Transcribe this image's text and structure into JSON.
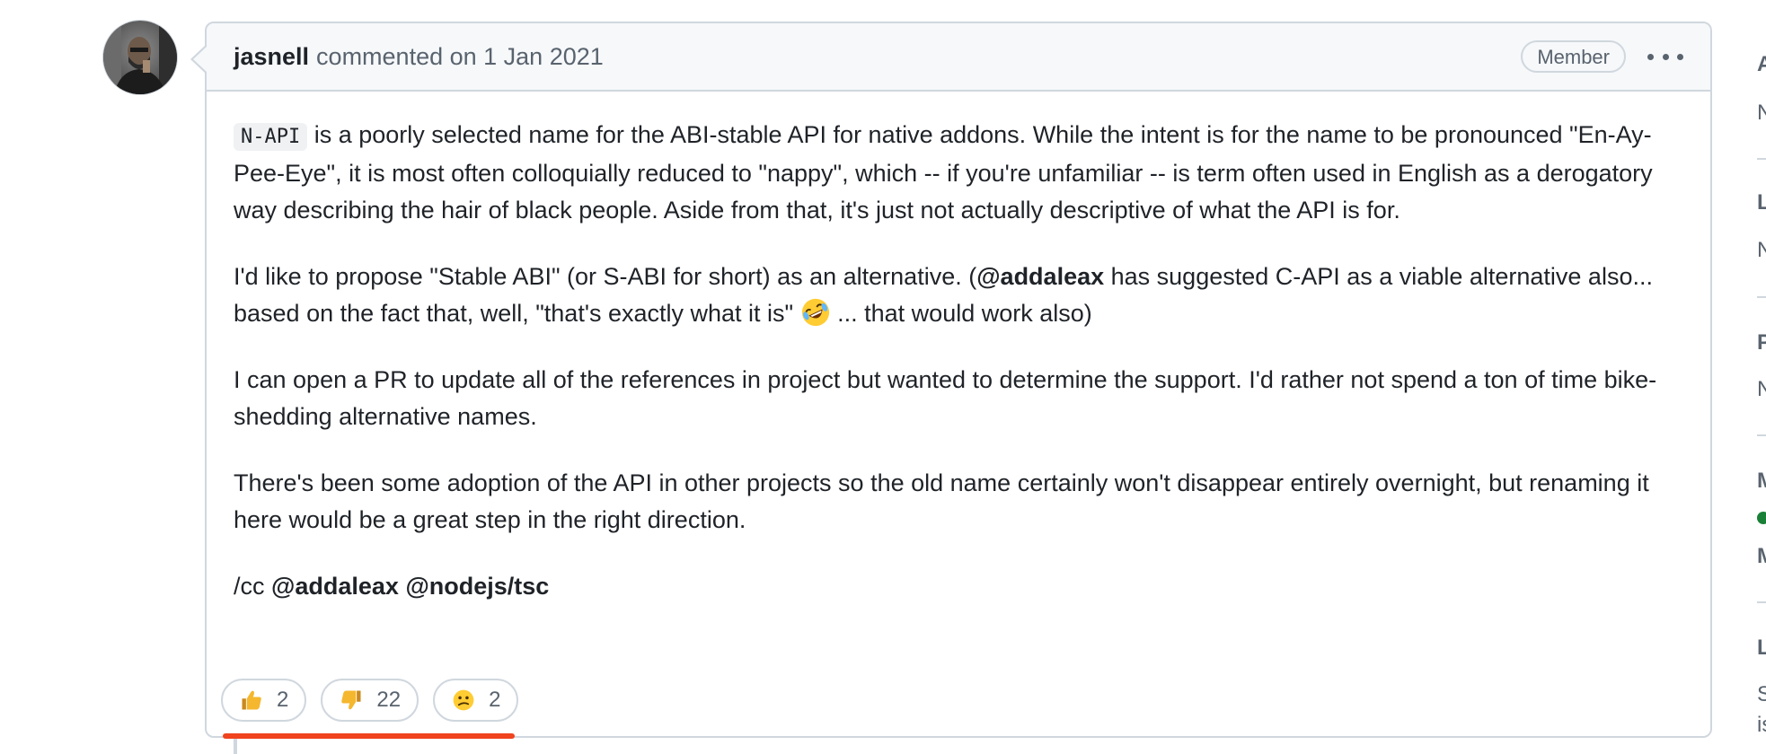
{
  "comment": {
    "author": "jasnell",
    "action": "commented on 1 Jan 2021",
    "role_badge": "Member",
    "body": {
      "p1_code": "N-API",
      "p1_text": " is a poorly selected name for the ABI-stable API for native addons. While the intent is for the name to be pronounced \"En-Ay-Pee-Eye\", it is most often colloquially reduced to \"nappy\", which -- if you're unfamiliar -- is term often used in English as a derogatory way describing the hair of black people. Aside from that, it's just not actually descriptive of what the API is for.",
      "p2_text_a": "I'd like to propose \"Stable ABI\" (or S-ABI for short) as an alternative. (",
      "p2_mention": "@addaleax",
      "p2_text_b": " has suggested C-API as a viable alternative also... based on the fact that, well, \"that's exactly what it is\" ",
      "p2_text_c": " ... that would work also)",
      "p3_text": "I can open a PR to update all of the references in project but wanted to determine the support. I'd rather not spend a ton of time bike-shedding alternative names.",
      "p4_text": "There's been some adoption of the API in other projects so the old name certainly won't disappear entirely overnight, but renaming it here would be a great step in the right direction.",
      "p5_prefix": "/cc ",
      "p5_mention_1": "@addaleax",
      "p5_mention_2": "@nodejs/tsc"
    },
    "reactions": [
      {
        "icon": "thumbs-up-icon",
        "count": "2"
      },
      {
        "icon": "thumbs-down-icon",
        "count": "22"
      },
      {
        "icon": "confused-face-icon",
        "count": "2"
      }
    ]
  },
  "sidebar": {
    "items": [
      "A",
      "N",
      "L",
      "N",
      "P",
      "N",
      "M",
      "M",
      "L",
      "S",
      "is"
    ]
  },
  "colors": {
    "border": "#d0d7de",
    "header_bg": "#f6f8fa",
    "highlight": "#f0431e",
    "status_green": "#1a7f37"
  }
}
